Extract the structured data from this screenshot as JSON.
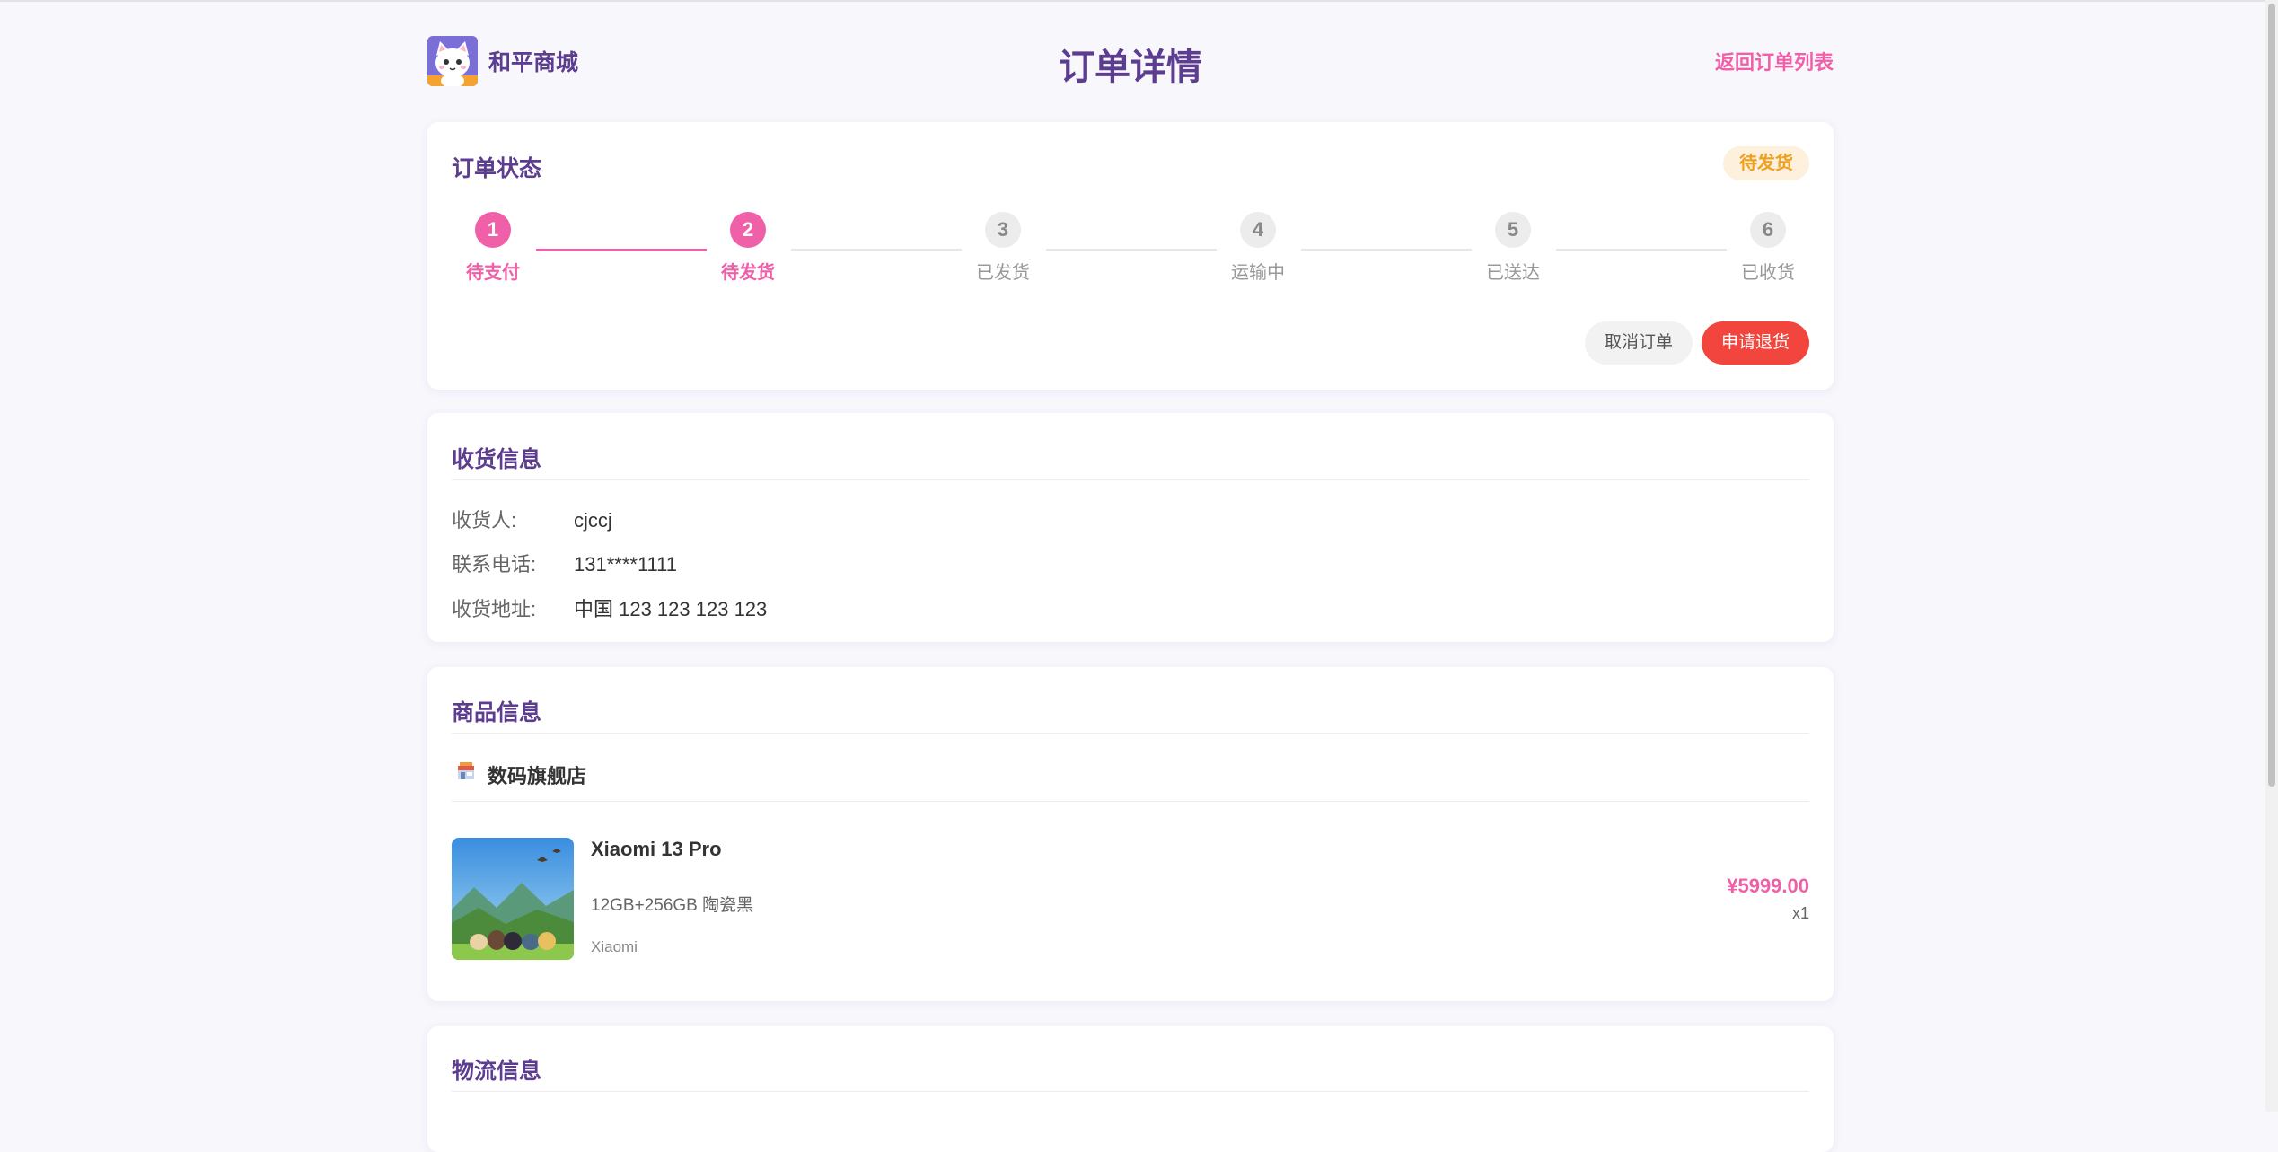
{
  "header": {
    "brand": "和平商城",
    "title": "订单详情",
    "back_link": "返回订单列表",
    "logo_icon": "cat-logo-icon"
  },
  "status": {
    "section_title": "订单状态",
    "badge": "待发货",
    "current_step": 2,
    "steps": [
      {
        "num": "1",
        "label": "待支付"
      },
      {
        "num": "2",
        "label": "待发货"
      },
      {
        "num": "3",
        "label": "已发货"
      },
      {
        "num": "4",
        "label": "运输中"
      },
      {
        "num": "5",
        "label": "已送达"
      },
      {
        "num": "6",
        "label": "已收货"
      }
    ],
    "actions": {
      "cancel": "取消订单",
      "return": "申请退货"
    }
  },
  "receiver": {
    "section_title": "收货信息",
    "rows": [
      {
        "key": "收货人:",
        "value": "cjccj"
      },
      {
        "key": "联系电话:",
        "value": "131****1111"
      },
      {
        "key": "收货地址:",
        "value": "中国 123 123 123 123"
      }
    ]
  },
  "products": {
    "section_title": "商品信息",
    "shop_name": "数码旗舰店",
    "shop_icon": "store-icon",
    "item": {
      "name": "Xiaomi 13 Pro",
      "spec": "12GB+256GB 陶瓷黑",
      "brand": "Xiaomi",
      "price": "¥5999.00",
      "qty": "x1"
    }
  },
  "logistics": {
    "section_title": "物流信息"
  },
  "colors": {
    "accent_pink": "#f060a8",
    "title_purple": "#5c3d8f",
    "danger_red": "#f2453d",
    "badge_orange": "#f0a020",
    "background": "#f8f7fc"
  }
}
